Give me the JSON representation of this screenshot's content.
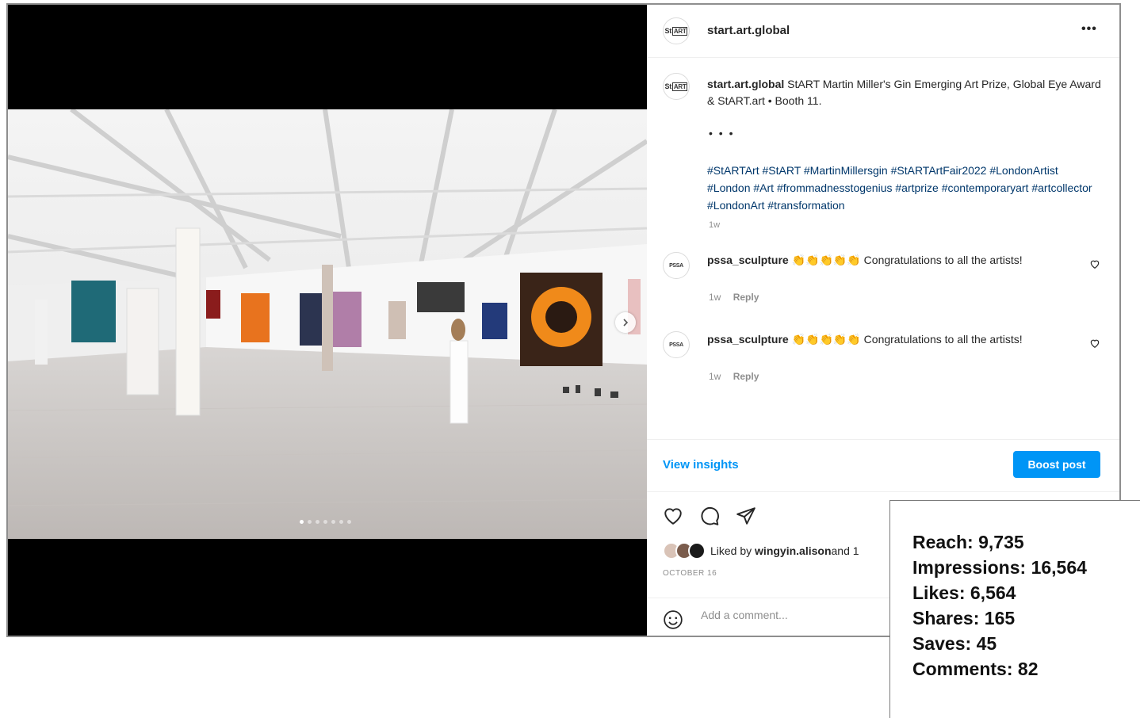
{
  "post": {
    "username": "start.art.global",
    "avatar_text": "St",
    "avatar_boxed_text": "ART",
    "more_label": "•••",
    "caption_username": "start.art.global",
    "caption_text": " StART Martin Miller's Gin Emerging Art Prize, Global Eye Award & StART.art • Booth 11.",
    "caption_ellipsis": "• • •",
    "hashtags": "#StARTArt #StART #MartinMillersgin #StARTArtFair2022 #LondonArtist #London #Art #frommadnesstogenius #artprize #contemporaryart #artcollector #LondonArt #transformation",
    "caption_time": "1w",
    "carousel": {
      "count": 7,
      "active_index": 0
    }
  },
  "comments": [
    {
      "avatar_text": "PSSA",
      "username": "pssa_sculpture",
      "emoji": "👏👏👏👏👏",
      "text": " Congratulations to all the artists!",
      "time": "1w",
      "reply_label": "Reply"
    },
    {
      "avatar_text": "PSSA",
      "username": "pssa_sculpture",
      "emoji": "👏👏👏👏👏",
      "text": " Congratulations to all the artists!",
      "time": "1w",
      "reply_label": "Reply"
    }
  ],
  "footer": {
    "view_insights_label": "View insights",
    "boost_label": "Boost post",
    "liked_by_prefix": "Liked by ",
    "liked_by_user": "wingyin.alison",
    "liked_by_suffix": " and 1",
    "date": "OCTOBER 16",
    "add_comment_placeholder": "Add a comment..."
  },
  "stats": [
    {
      "label": "Reach",
      "value": "9,735"
    },
    {
      "label": "Impressions",
      "value": "16,564"
    },
    {
      "label": "Likes",
      "value": "6,564"
    },
    {
      "label": "Shares",
      "value": "165"
    },
    {
      "label": "Saves",
      "value": "45"
    },
    {
      "label": "Comments",
      "value": "82"
    }
  ],
  "colors": {
    "accent": "#0095f6",
    "hashtag": "#00376b",
    "muted": "#8e8e8e",
    "clap": "#f2b705"
  }
}
